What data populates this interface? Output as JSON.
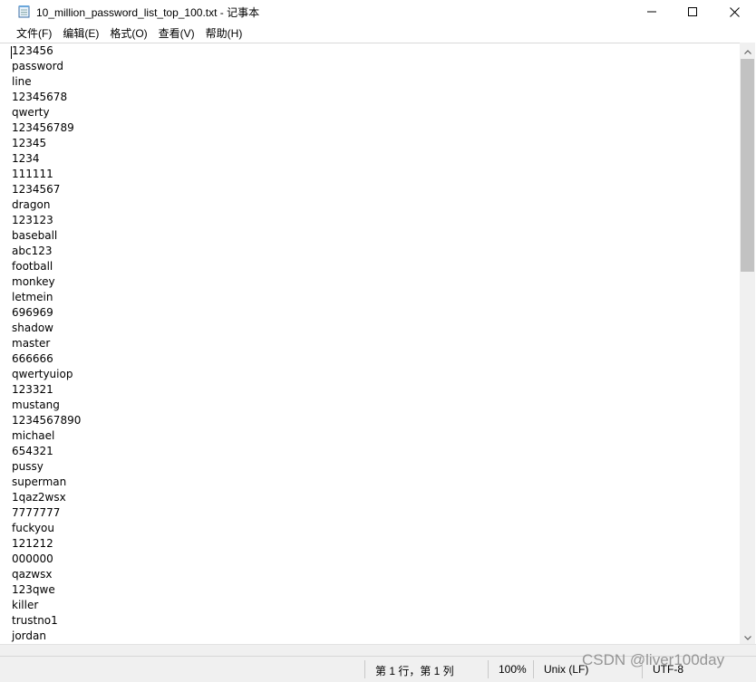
{
  "window": {
    "title": "10_million_password_list_top_100.txt - 记事本",
    "icon": "notepad-icon",
    "controls": {
      "minimize_icon": "minimize-icon",
      "maximize_icon": "maximize-icon",
      "close_icon": "close-icon"
    }
  },
  "menu": {
    "items": [
      {
        "label": "文件(F)"
      },
      {
        "label": "编辑(E)"
      },
      {
        "label": "格式(O)"
      },
      {
        "label": "查看(V)"
      },
      {
        "label": "帮助(H)"
      }
    ]
  },
  "editor": {
    "lines": [
      "123456",
      "password",
      "line",
      "12345678",
      "qwerty",
      "123456789",
      "12345",
      "1234",
      "111111",
      "1234567",
      "dragon",
      "123123",
      "baseball",
      "abc123",
      "football",
      "monkey",
      "letmein",
      "696969",
      "shadow",
      "master",
      "666666",
      "qwertyuiop",
      "123321",
      "mustang",
      "1234567890",
      "michael",
      "654321",
      "pussy",
      "superman",
      "1qaz2wsx",
      "7777777",
      "fuckyou",
      "121212",
      "000000",
      "qazwsx",
      "123qwe",
      "killer",
      "trustno1",
      "jordan"
    ]
  },
  "scrollbar": {
    "up_icon": "scroll-up-arrow-icon",
    "down_icon": "scroll-down-arrow-icon"
  },
  "status": {
    "position": "第 1 行，第 1 列",
    "zoom": "100%",
    "line_ending": "Unix (LF)",
    "encoding": "UTF-8"
  },
  "watermark": "CSDN @liver100day"
}
